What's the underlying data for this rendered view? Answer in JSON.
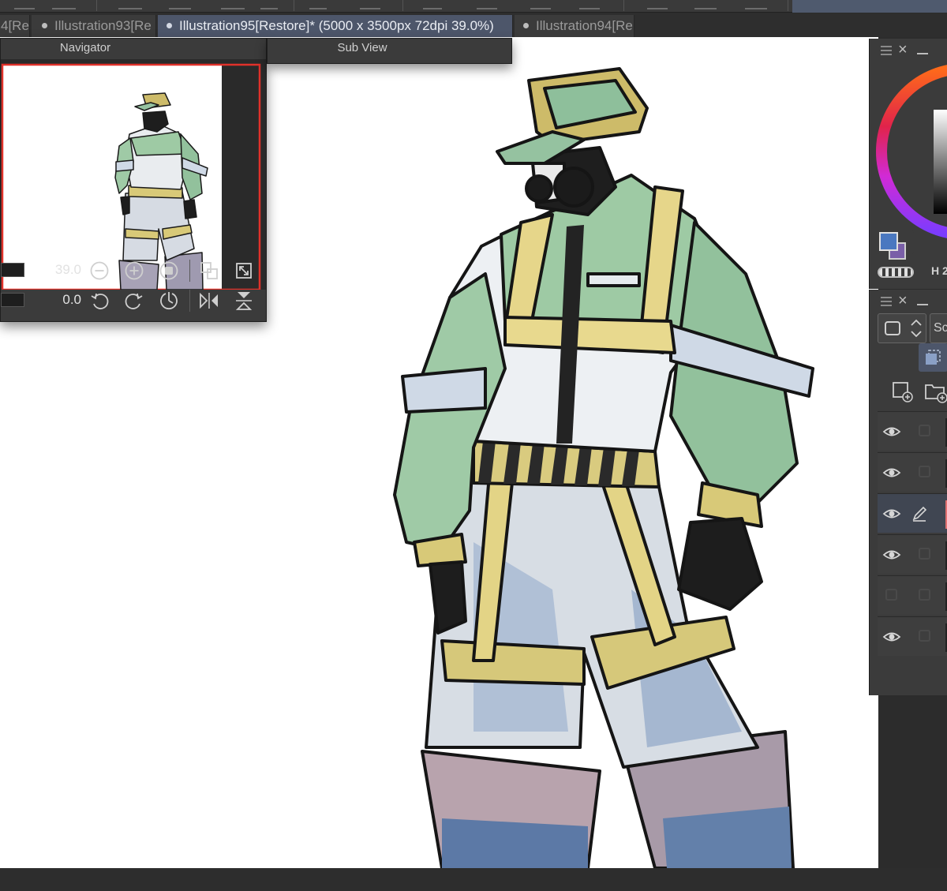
{
  "tabs": [
    {
      "label": "4[Re",
      "active": false,
      "dot": false
    },
    {
      "label": "Illustration93[Re",
      "active": false,
      "dot": true
    },
    {
      "label": "Illustration95[Restore]* (5000 x 3500px 72dpi 39.0%)",
      "active": true,
      "dot": true
    },
    {
      "label": "Illustration94[Re",
      "active": false,
      "dot": true
    }
  ],
  "navigator": {
    "title": "Navigator",
    "zoom_value": "39.0",
    "rotation_value": "0.0"
  },
  "subview": {
    "title": "Sub View"
  },
  "color_panel": {
    "main_color": "#4a78c0",
    "sub_color": "#7a5fa8",
    "h_label": "H 2"
  },
  "layer_panel": {
    "blend_mode_label": "Scr",
    "layers": [
      {
        "visible": true,
        "editing": false,
        "selected": false
      },
      {
        "visible": true,
        "editing": false,
        "selected": false
      },
      {
        "visible": true,
        "editing": true,
        "selected": true
      },
      {
        "visible": true,
        "editing": false,
        "selected": false
      },
      {
        "visible": false,
        "editing": false,
        "selected": false
      },
      {
        "visible": true,
        "editing": false,
        "selected": false
      }
    ]
  },
  "colors": {
    "active_tab": "#4d566a",
    "panel_bg": "#3b3b3b",
    "accent_red": "#e0312a"
  }
}
